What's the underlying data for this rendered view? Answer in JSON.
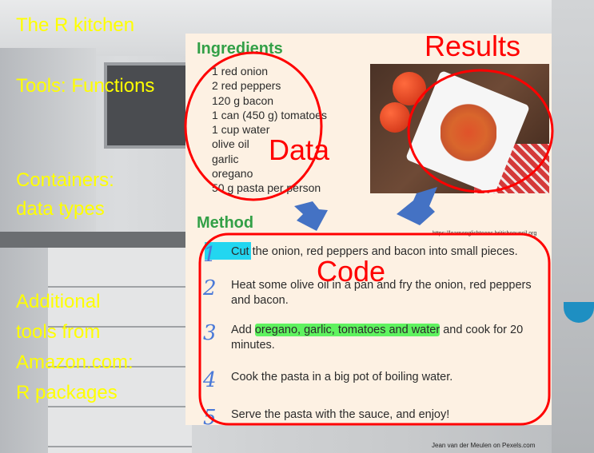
{
  "left_labels": {
    "l1": "The R kitchen",
    "l2": "Tools: Functions",
    "l3a": "Containers:",
    "l3b": "data types",
    "l4a": "Additional",
    "l4b": "tools from",
    "l4c": "Amazon.com:",
    "l4d": "R packages"
  },
  "card": {
    "ingredients_heading": "Ingredients",
    "ingredients": [
      "1 red onion",
      "2 red peppers",
      "120 g bacon",
      "1 can (450 g) tomatoes",
      "1 cup water",
      "olive oil",
      "garlic",
      "oregano",
      "50 g pasta per person"
    ],
    "method_heading": "Method",
    "source": "https://learnenglishteens.britishcouncil.org",
    "steps": [
      {
        "num": "1",
        "a": "Cut",
        "b": " the onion, red peppers and bacon into small pieces."
      },
      {
        "num": "2",
        "text": "Heat some olive oil in a pan and fry the onion, red peppers and bacon."
      },
      {
        "num": "3",
        "a": "Add ",
        "b": "oregano, garlic, tomatoes and water",
        "c": " and cook for 20 minutes."
      },
      {
        "num": "4",
        "text": "Cook the pasta in a big pot of boiling water."
      },
      {
        "num": "5",
        "text": "Serve the pasta with the sauce, and enjoy!"
      }
    ]
  },
  "annotations": {
    "results": "Results",
    "data": "Data",
    "code": "Code"
  },
  "credit": "Jean van der Meulen on Pexels.com",
  "colors": {
    "label_yellow": "#ffff00",
    "heading_green": "#33a047",
    "annotation_red": "#ff0000",
    "arrow_blue": "#4472c4"
  }
}
